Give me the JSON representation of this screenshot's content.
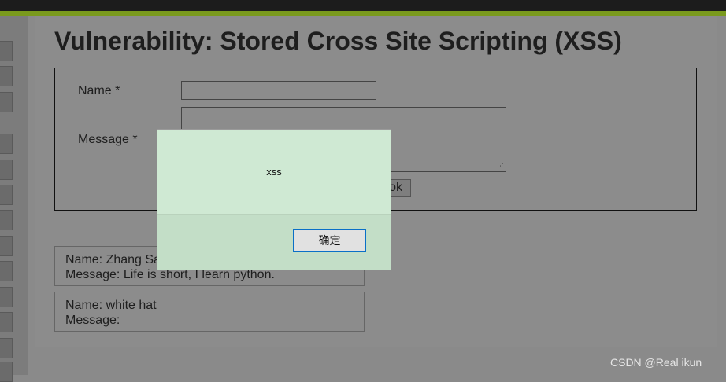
{
  "page": {
    "title": "Vulnerability: Stored Cross Site Scripting (XSS)"
  },
  "form": {
    "name_label": "Name *",
    "name_value": "",
    "message_label": "Message *",
    "message_value": "",
    "sign_button_label": "ok"
  },
  "entries": [
    {
      "name": "Name: Zhang Sa",
      "message": "Message: Life is short, I learn python."
    },
    {
      "name": "Name: white hat",
      "message": "Message:"
    }
  ],
  "dialog": {
    "message": "xss",
    "confirm_label": "确定"
  },
  "watermark": "CSDN @Real  ikun",
  "colors": {
    "stripe": "#7a9a1d",
    "dialog_bg": "#cfe9d3",
    "ok_border": "#0a6fc7"
  }
}
